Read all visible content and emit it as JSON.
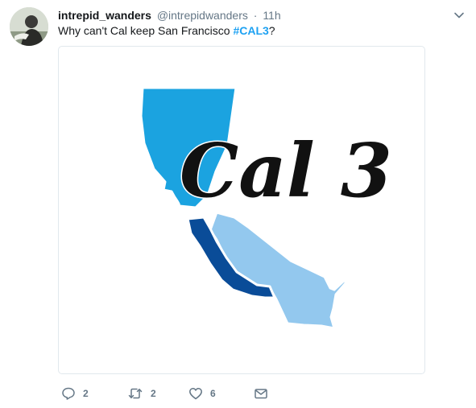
{
  "tweet": {
    "display_name": "intrepid_wanders",
    "handle": "@intrepidwanders",
    "separator": "·",
    "time": "11h",
    "text": "Why can't Cal keep San Francisco ",
    "hashtag": "#CAL3",
    "text_end": "?"
  },
  "media": {
    "overlay_text": "Cal 3",
    "colors": {
      "north": "#1ba3e0",
      "central_coast": "#0a4c98",
      "south": "#93c8ee",
      "outline": "#ffffff",
      "lettering": "#111111"
    }
  },
  "actions": {
    "reply_count": "2",
    "retweet_count": "2",
    "like_count": "6"
  },
  "colors": {
    "accent": "#1da1f2",
    "muted": "#657786",
    "text": "#14171a"
  }
}
